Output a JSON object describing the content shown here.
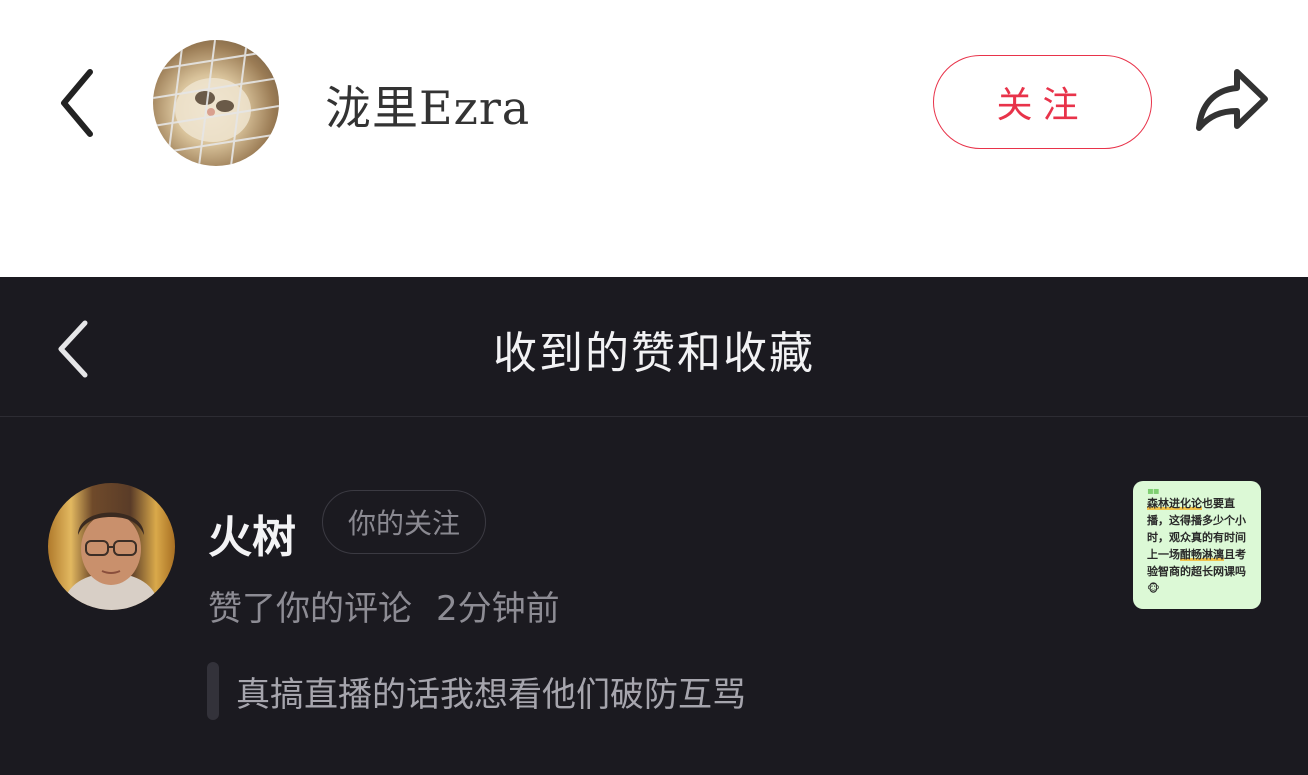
{
  "profile_header": {
    "name": "泷里Ezra",
    "follow_label": "关注"
  },
  "notifications_page": {
    "title": "收到的赞和收藏"
  },
  "notification": {
    "user_name": "火树",
    "badge": "你的关注",
    "action": "赞了你的评论",
    "time": "2分钟前",
    "comment": "真搞直播的话我想看他们破防互骂",
    "thumbnail_text": {
      "highlight_1": "森林进化论",
      "part_1": "也要直播，这得播多少个小时，观众真的有时间上一场",
      "highlight_2": "酣畅淋漓",
      "part_2": "且考验智商的超长网课吗🐵"
    }
  },
  "colors": {
    "accent": "#e8334a",
    "dark_bg": "#1b1a20",
    "thumb_bg": "#dcf9d6"
  },
  "icons": [
    "back-arrow-icon",
    "share-icon",
    "back-chevron-icon"
  ]
}
